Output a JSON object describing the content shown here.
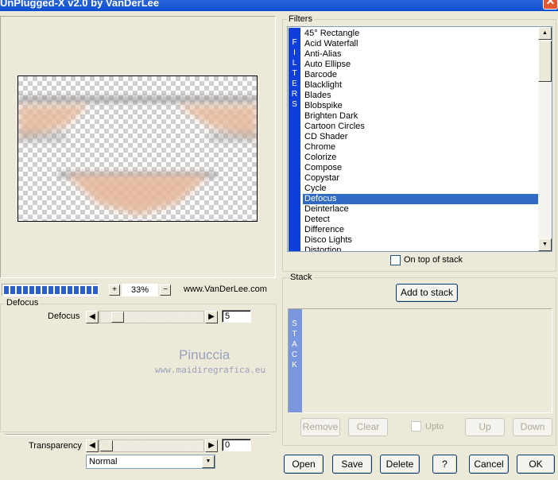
{
  "window": {
    "title": "UnPlugged-X v2.0 by VanDerLee",
    "close_glyph": "✕"
  },
  "zoom": {
    "plus": "+",
    "value": "33%",
    "minus": "−",
    "website": "www.VanDerLee.com",
    "progress_fraction": 1.0
  },
  "filters": {
    "legend": "Filters",
    "strip_letters": [
      "F",
      "I",
      "L",
      "T",
      "E",
      "R",
      "S"
    ],
    "items": [
      "45° Rectangle",
      "Acid Waterfall",
      "Anti-Alias",
      "Auto Ellipse",
      "Barcode",
      "Blacklight",
      "Blades",
      "Blobspike",
      "Brighten Dark",
      "Cartoon Circles",
      "CD Shader",
      "Chrome",
      "Colorize",
      "Compose",
      "Copystar",
      "Cycle",
      "Defocus",
      "Deinterlace",
      "Detect",
      "Difference",
      "Disco Lights",
      "Distortion"
    ],
    "selected": "Defocus",
    "on_top_label": "On top of stack",
    "on_top_checked": false
  },
  "stack": {
    "legend": "Stack",
    "add_button": "Add to stack",
    "strip_letters": [
      "S",
      "T",
      "A",
      "C",
      "K"
    ],
    "remove": "Remove",
    "clear": "Clear",
    "upto": "Upto",
    "up": "Up",
    "down": "Down"
  },
  "defocus": {
    "legend": "Defocus",
    "param_label": "Defocus",
    "value": "5",
    "slider_fraction": 0.12
  },
  "watermark": {
    "name": "Pinuccia",
    "url": "www.maidiregrafica.eu"
  },
  "transparency": {
    "label": "Transparency",
    "value": "0",
    "slider_fraction": 0.0,
    "blend_mode": "Normal"
  },
  "buttons": {
    "open": "Open",
    "save": "Save",
    "delete": "Delete",
    "help": "?",
    "cancel": "Cancel",
    "ok": "OK"
  },
  "glyphs": {
    "left_arrow": "◀",
    "right_arrow": "▶",
    "up_arrow": "▲",
    "down_arrow": "▼"
  },
  "colors": {
    "selection": "#316ac5",
    "filter_strip": "#0e3fd9",
    "stack_strip": "#7a96df",
    "title_bar": "#0b4fd0"
  }
}
